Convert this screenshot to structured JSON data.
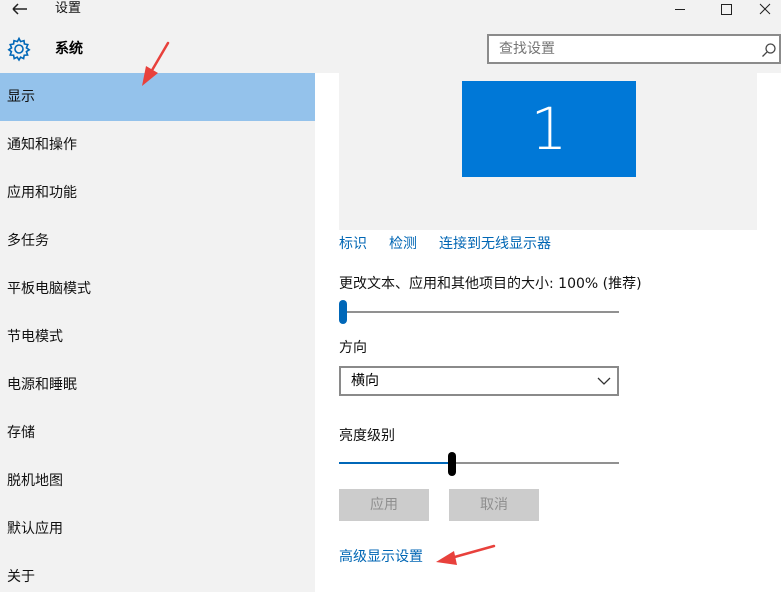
{
  "window": {
    "title": "设置",
    "back_icon": "back-arrow-icon",
    "controls": [
      "minimize-icon",
      "maximize-icon",
      "close-icon"
    ]
  },
  "sidebar": {
    "header_icon": "gear-icon",
    "header_title": "系统",
    "items": [
      {
        "label": "显示",
        "selected": true
      },
      {
        "label": "通知和操作"
      },
      {
        "label": "应用和功能"
      },
      {
        "label": "多任务"
      },
      {
        "label": "平板电脑模式"
      },
      {
        "label": "节电模式"
      },
      {
        "label": "电源和睡眠"
      },
      {
        "label": "存储"
      },
      {
        "label": "脱机地图"
      },
      {
        "label": "默认应用"
      },
      {
        "label": "关于"
      }
    ]
  },
  "search": {
    "placeholder": "查找设置",
    "icon": "search-icon"
  },
  "display": {
    "monitor_number": "1",
    "links": [
      "标识",
      "检测",
      "连接到无线显示器"
    ],
    "scale_label": "更改文本、应用和其他项目的大小: 100% (推荐)",
    "scale_slider_value": 0,
    "orientation_label": "方向",
    "orientation_value": "横向",
    "brightness_label": "亮度级别",
    "brightness_slider_value": 0.4,
    "apply_button": "应用",
    "cancel_button": "取消",
    "advanced_link": "高级显示设置"
  },
  "colors": {
    "accent": "#0078d7",
    "selected_nav": "#94c2eb",
    "link": "#0066b4",
    "annotation_arrow": "#e8413c"
  }
}
